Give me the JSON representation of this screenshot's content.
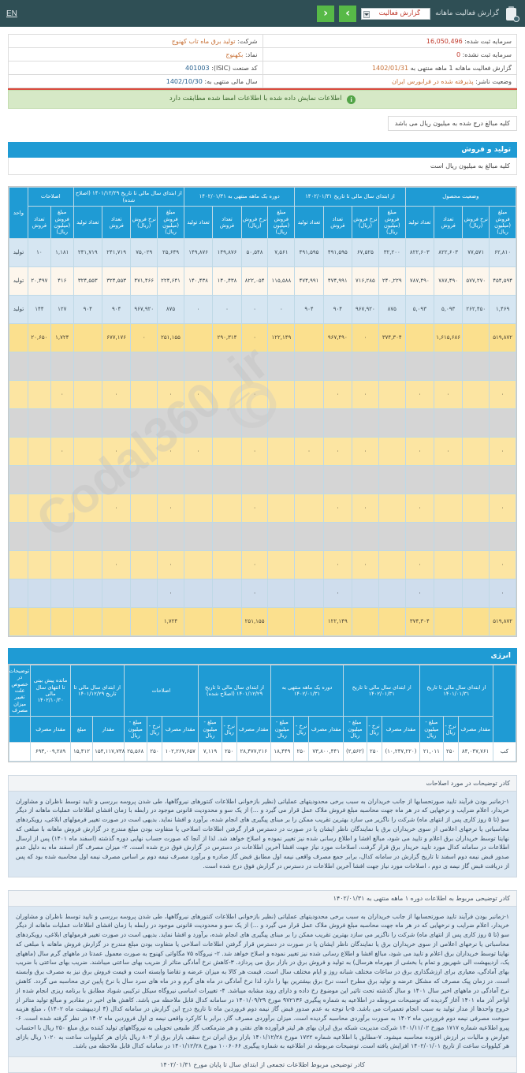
{
  "topbar": {
    "report_title": "گزارش فعالیت ماهانه",
    "select_value": "گزارش فعالیت",
    "prev_label": "‹",
    "next_label": "›",
    "en_label": "EN"
  },
  "info": {
    "company_label": "شرکت:",
    "company_value": "تولید برق ماه تاب کهنوج",
    "capital_registered_label": "سرمایه ثبت شده:",
    "capital_registered_value": "16,050,496",
    "symbol_label": "نماد:",
    "symbol_value": "بکهنوج",
    "capital_unregistered_label": "سرمایه ثبت نشده:",
    "capital_unregistered_value": "0",
    "isic_label": "کد صنعت (ISIC):",
    "isic_value": "401003",
    "period_label": "گزارش فعالیت ماهانه 1 ماهه منتهی به",
    "period_value": "1402/01/31",
    "fiscal_label": "سال مالی منتهی به:",
    "fiscal_value": "1402/10/30",
    "status_label": "وضعیت ناشر:",
    "status_value": "پذیرفته شده در فرابورس ایران",
    "notice": "اطلاعات نمایش داده شده با اطلاعات امضا شده مطابقت دارد",
    "unit_note": "کلیه مبالغ درج شده به میلیون ریال می باشد"
  },
  "production": {
    "section_title": "تولید و فروش",
    "section_sub": "کلیه مبالغ به میلیون ریال است",
    "group_headers": [
      "اصلاحات",
      "از ابتدای سال مالی تا تاریخ ۱۴۰۱/۱۲/۲۹ (اصلاح شده)",
      "دوره یک ماهه منتهی به ۱۴۰۲/۰۱/۳۱",
      "از ابتدای سال مالی تا تاریخ ۱۴۰۲/۰۱/۳۱",
      "از ابتدای سال مالی تا تاریخ ۱۴۰۱/۰۱/۳۱",
      "وضعیت محصول"
    ],
    "sub_headers": {
      "amount": "مبلغ فروش (میلیون ریال)",
      "rate": "نرخ فروش (ریال)",
      "sales_qty": "تعداد فروش",
      "prod_qty": "تعداد تولید",
      "unit": "واحد"
    },
    "rows": [
      {
        "style": "r-blue",
        "unit": "تولید",
        "cells": [
          "۶۲,۸۱۰",
          "۷۷,۵۷۱",
          "۸۲۲,۶۰۳",
          "۸۲۲,۶۰۳",
          "۳۲,۲۰۰",
          "۶۷,۵۲۵",
          "۴۹۱,۵۹۵",
          "۴۹۱,۵۹۵",
          "۷,۵۶۱",
          "۵۰,۵۴۸",
          "۱۴۹,۸۷۶",
          "۱۴۹,۸۷۶",
          "۲۵,۶۴۹",
          "۷۵,۰۲۹",
          "۲۴۱,۷۱۹",
          "۲۴۱,۷۱۹",
          "۱,۱۸۱",
          "۱۰"
        ]
      },
      {
        "style": "r-cream",
        "unit": "تولید",
        "cells": [
          "۴۵۴,۵۹۴",
          "۵۷۷,۲۷۰",
          "۷۸۷,۴۹۰",
          "۷۸۷,۴۹۰",
          "۲۴۰,۲۲۹",
          "۷۱۶,۲۸۵",
          "۴۷۴,۹۹۱",
          "۴۷۴,۹۹۱",
          "۱۱۵,۵۸۸",
          "۸۲۲,۰۵۴",
          "۱۴۰,۴۳۸",
          "۱۴۰,۴۳۸",
          "۲۲۴,۶۴۱",
          "۴۷۱,۴۶۶",
          "۳۲۴,۵۵۳",
          "۳۲۴,۵۵۳",
          "۴۱۶",
          "۲۰,۴۹۷"
        ]
      },
      {
        "style": "r-blue",
        "unit": "تولید",
        "cells": [
          "۱,۴۶۹",
          "۲۶۲,۴۵۰",
          "۵,۰۹۳",
          "۵,۰۹۳",
          "۸۷۵",
          "۹۶۷,۹۲۰",
          "۹۰۴",
          "۹۰۴",
          "۰",
          "۰",
          "۰",
          "۰",
          "۸۷۵",
          "۹۶۷,۹۲۰",
          "۹۰۴",
          "۹۰۴",
          "۱۲۷",
          "۱۴۴"
        ]
      },
      {
        "style": "r-yellow",
        "unit": "",
        "cells": [
          "۵۱۹,۸۷۲",
          "",
          "۱,۶۱۵,۶۸۶",
          "",
          "۳۷۴,۳۰۴",
          "۰",
          "۹۶۷,۴۹۰",
          "",
          "۱۲۲,۱۴۹",
          "۰",
          "۲۹۰,۳۱۴",
          "",
          "۲۵۱,۱۵۵",
          "۰",
          "۶۷۷,۱۷۶",
          "",
          "۱,۷۲۴",
          "۲۰,۶۵۰"
        ]
      },
      {
        "style": "r-grey",
        "unit": "",
        "cells": [
          "",
          "",
          "",
          "",
          "",
          "",
          "",
          "",
          "",
          "",
          "",
          "",
          "",
          "",
          "",
          "",
          "",
          ""
        ]
      },
      {
        "style": "r-yellow-l",
        "unit": "",
        "cells": [
          "۰",
          "",
          "۰",
          "۰",
          "",
          "۰",
          "۰",
          "",
          "",
          "۰",
          "",
          "۰",
          "۰",
          "",
          "۰",
          "",
          "۰",
          ""
        ]
      },
      {
        "style": "r-grey",
        "unit": "",
        "cells": [
          "",
          "",
          "",
          "",
          "",
          "",
          "",
          "",
          "",
          "",
          "",
          "",
          "",
          "",
          "",
          "",
          "",
          ""
        ]
      },
      {
        "style": "r-yellow-l",
        "unit": "",
        "cells": [
          "۰",
          "",
          "۰",
          "۰",
          "",
          "۰",
          "۰",
          "۰",
          "",
          "۰",
          "",
          "۰",
          "۰",
          "",
          "۰",
          "",
          "۰",
          ""
        ]
      },
      {
        "style": "r-grey",
        "unit": "",
        "cells": [
          "",
          "",
          "",
          "",
          "",
          "",
          "",
          "",
          "",
          "",
          "",
          "",
          "",
          "",
          "",
          "",
          "",
          ""
        ]
      },
      {
        "style": "r-yellow-l",
        "unit": "",
        "cells": [
          "۰",
          "",
          "",
          "۰",
          "",
          "۰",
          "۰",
          "",
          "",
          "۰",
          "",
          "",
          "۰",
          "",
          "۰",
          "",
          "",
          ""
        ]
      },
      {
        "style": "r-grey",
        "unit": "",
        "cells": [
          "",
          "",
          "",
          "",
          "",
          "",
          "",
          "",
          "",
          "",
          "",
          "",
          "",
          "",
          "",
          "",
          "",
          ""
        ]
      },
      {
        "style": "r-yellow-l",
        "unit": "",
        "cells": [
          "۰",
          "",
          "",
          "۰",
          "",
          "۰",
          "۰",
          "",
          "",
          "۰",
          "",
          "",
          "۰",
          "",
          "۰",
          "",
          "",
          ""
        ]
      },
      {
        "style": "r-blue-s",
        "unit": "",
        "cells": [
          "۰",
          "",
          "",
          "۰",
          "",
          "",
          "۰",
          "",
          "",
          "۰",
          "",
          "",
          "۰",
          "",
          "",
          "",
          "",
          ""
        ]
      },
      {
        "style": "r-yellow",
        "unit": "",
        "cells": [
          "۵۱۹,۸۷۲",
          "",
          "",
          "۳۷۴,۳۰۴",
          "",
          "",
          "۱۲۲,۱۴۹",
          "",
          "",
          "۲۵۱,۱۵۵",
          "",
          "",
          "۱,۷۲۴",
          "",
          "",
          "",
          "",
          ""
        ]
      }
    ]
  },
  "energy": {
    "section_title": "انرژی",
    "group_headers": [
      "از ابتدای سال مالی تا تاریخ ۱۴۰۱/۱۲/۲۹",
      "اصلاحات",
      "از ابتدای سال مالی تا تاریخ ۱۴۰۱/۱۲/۲۹ (اصلاح شده)",
      "دوره یک ماهه منتهی به ۱۴۰۲/۰۱/۳۱",
      "از ابتدای سال مالی تا تاریخ ۱۴۰۲/۰۱/۳۱",
      "از ابتدای سال مالی تا تاریخ ۱۴۰۱/۰۱/۳۱",
      "مانده پیش بینی تا انتهای سال مالی ۱۴۰۲/۱۰/۳۰",
      "توضیحات در خصوص علت تغییر میزان مصرف"
    ],
    "sub_headers": {
      "qty": "مقدار مصرف",
      "rate": "نرخ - ریال",
      "amount": "مبلغ - میلیون ریال",
      "qty2": "مقدار",
      "amount2": "مبلغ",
      "qty3": "مقدار مصرف"
    },
    "row": {
      "name": "کب",
      "cells": [
        "۸۴,۰۴۷,۷۶۱",
        "۲۵۰",
        "۲۱,۰۱۱",
        "(۱۰,۲۴۷,۲۲۰)",
        "۲۵۰",
        "(۲,۵۶۲)",
        "۷۳,۸۰۰,۴۴۱",
        "۲۵۰",
        "۱۸,۴۴۹",
        "۲۸,۴۷۷,۲۱۶",
        "۲۵۰",
        "۷,۱۱۹",
        "۱۰۲,۲۶۷,۶۵۷",
        "۲۵۰",
        "۲۵,۵۶۸",
        "۱۵۴,۱۱۷,۷۳۸",
        "۱۵,۴۱۲",
        "۶۹۳,۰۰۹,۲۸۹"
      ]
    }
  },
  "notes": [
    {
      "head": "کادر توضیحات در مورد اصلاحات",
      "body": "۱-زمانبر بودن فرآیند تایید صورتحسابها از جانب خریداران به سبب برخی محدودیتهای عملیاتی (نظیر بازخوانی اطلاعات کنتورهای نیروگاهها، طی شدن پروسه بررسی و تایید توسط ناظران و مشاوران خریدار، اعلام ضرایب و نرخهایی که در هر ماه جهت محاسبه مبلغ فروش ملاک عمل قرار می گیرد و ...) از یک سو و محدودیت قانونی موجود در رابطه با زمان افشای اطلاعات عملیات ماهانه از دیگر سو (تا ۵ روز کاری پس از انتهای ماه) شرکت را ناگزیر می سازد بهترین تقریب ممکن را بر مبنای پیگیری های انجام شده، برآورد و افشا نماید. بدیهی است در صورت تغییر فرمولهای ابلاغی، رویکردهای محاسباتی یا نرخهای اعلامی از سوی خریداران برق یا نمایندگان ناظر ایشان یا در صورت در دسترس قرار گرفتن اطلاعات اصلاحی یا متفاوت بودن مبلغ مندرج در گزارش فروش ماهانه با مبلغی که نهایتا توسط خریداران برق اعلام و تایید می شود، مبالغ افشا و اطلاع رسانی شده نیز تغییر نموده و اصلاح خواهد شد. لذا از آنجا که صورت حساب نهایی دوره گذشته (اسفند ماه ۱۴۰۱) پس از ارسال اطلاعات در سامانه کدال مورد تایید خریدار برق قرار گرفت، اصلاحات مورد نیاز جهت افشا آخرین اطلاعات در دسترس در گزارش فوق درج شده است. ۲- میزان مصرف گاز اسفند ماه به دلیل عدم صدور قبض نیمه دوم اسفند تا تاریخ گزارش در سامانه کدال، برابر جمع مصرف واقعی نیمه اول مطابق قبض گاز صادره و برآورد مصرف نیمه دوم بر اساس مصرف نیمه اول محاسبه شده بود که پس از دریافت قبض گاز نیمه ی دوم ، اصلاحات مورد نیاز جهت افشا آخرین اطلاعات در دسترس در گزارش فوق درج شده است.",
      "foot": ""
    },
    {
      "head": "کادر توضیحی مربوط به اطلاعات دوره ۱ ماهه منتهی به ۱۴۰۲/۰۱/۳۱",
      "body": "۱-زمانبر بودن فرآیند تایید صورتحسابها از جانب خریداران به سبب برخی محدودیتهای عملیاتی (نظیر بازخوانی اطلاعات کنتورهای نیروگاهها، طی شدن پروسه بررسی و تایید توسط ناظران و مشاوران خریدار، اعلام ضرایب و نرخهایی که در هر ماه جهت محاسبه مبلغ فروش ملاک عمل قرار می گیرد و ...) از یک سو و محدودیت قانونی موجود در رابطه با زمان افشای اطلاعات عملیات ماهانه از دیگر سو (تا ۵ روز کاری پس از انتهای ماه) شرکت را ناگزیر می سازد بهترین تقریب ممکن را بر مبنای پیگیری های انجام شده، برآورد و افشا نماید. بدیهی است در صورت تغییر فرمولهای ابلاغی، رویکردهای محاسباتی یا نرخهای اعلامی از سوی خریداران برق یا نمایندگان ناظر ایشان یا در صورت در دسترس قرار گرفتن اطلاعات اصلاحی یا متفاوت بودن مبلغ مندرج در گزارش فروش ماهانه با مبلغی که نهایتا توسط خریداران برق اعلام و تایید می شود، مبالغ افشا و اطلاع رسانی شده نیز تغییر نموده و اصلاح خواهد شد. ۲- نیروگاه ۷۵ مگاواتی کهنوج به صورت معمول عمدتا در ماههای گرم سال (ماههای یک، اردیبهشت الی شهریور و تمام یا بخشی از مهرماه هرسال) به تولید و فروش برق در بازار برق می پردازد. ۳-کاهش نرخ آمادگی متاثر از ضریب بهای ساعتی میباشند. ضریب بهای ساعتی با ضریب بهای آمادگی، معیاری برای ارزشگذاری برق در ساعات مختلف شبانه روز و ایام مختلف سال است. قیمت هر کالا به میزان عرضه و تقاضا وابسته است و قیمت فروش برق نیز به مصرف برق وابسته است. در زمان پیک مصرف که مشکل عرضه و تولید برق مطرح است نرخ برق بیشترین بها را دارد لذا نرخ آمادگی در ماه های گرم و در ماه های سرد سال با نرخ پایین تری محاسبه می گردد. کاهش نرخ آمادگی در ماههای اخیر سال ۱۴۰۱ و سال گذشته تحت تاثیر این موضوع رخ داده و دارای روند مشابه میباشد. ۴- تغییرات اساسی نیروگاه سیکل ترکیبی شوباد مطابق با برنامه ریزی انجام شده از اواخر آذر ماه ۱۴۰۱ آغاز گردیده که توضیحات مربوطه در اطلاعیه به شماره پیگیری ۹۷۲۱۳۶ مورخ ۱۴۰۱/۰۹/۲۹ در سامانه کدال قابل ملاحظه می باشد. کاهش های اخیر در مقادیر و مبالغ تولید متاثر از خروج واحدها از مدار تولید به سبب انجام تعمیرات می باشد. ۵-با توجه به عدم صدور قبض گاز نیمه دوم فروردین ماه تا تاریخ درج این گزارش در سامانه کدال (۴ اردیبهشت ماه ۱۴۰۲) ، مبلغ هزینه سوخت مصرفی نیمه دوم فروردین ماه ۱۴۰۲ به صورت برآوردی محاسبه گردیده است. میزان برآوردی مصرف گاز، برابر با کارکرد واقعی نیمه ی اول فروردین ماه ۱۴۰۲ در نظر گرفته شده است. ۶- پیرو اطلاعیه شماره ۱۷۱۷ مورخ ۱۴۰۱/۱۱/۰۲ شرکت مدیریت شبکه برق ایران بهای هر لیتر فرآورده های نفتی و هر مترمکعب گاز طبیعی تحویلی به نیروگاههای تولید کننده برق مبلغ ۲۵۰ ریال با احتساب عوارض و مالیات بر ارزش افزوده محاسبه میشود. ۷-مطابق با اطلاعیه شماره ۱۷۲۲ مورخ ۱۴۰۱/۱۲/۲۸ بازار برق ایران نرخ سقف بازار برق از ۸۰۳ ریال بازای هر کیلووات ساعت به ۱۰۲۰ ریال بازای هر کیلووات ساعت از تاریخ ۱۴۰۲/۰۱/۰۱ افزایش یافته است. توضیحات مربوطه در اطلاعیه به شماره پیگیری ۱۰۰۶۰۶۶ مورخ ۱۴۰۱/۱۲/۲۸ در سامانه کدال قابل ملاحظه می باشد.",
      "foot": "کادر توضیحی مربوط اطلاعات تجمعی از ابتدای سال تا پایان مورخ ۱۴۰۲/۰۱/۳۱"
    }
  ],
  "watermark": {
    "text": "Codal360_ir"
  }
}
